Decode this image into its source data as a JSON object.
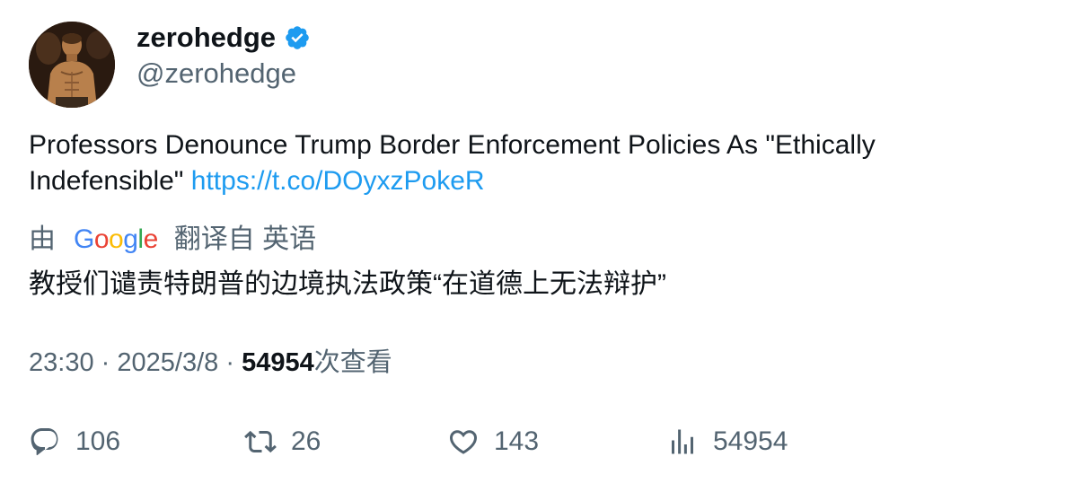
{
  "author": {
    "display_name": "zerohedge",
    "handle": "@zerohedge",
    "verified_icon": "verified-badge-icon",
    "verified_color": "#1d9bf0"
  },
  "tweet": {
    "text": "Professors Denounce Trump Border Enforcement Policies As \"Ethically Indefensible\" ",
    "link": "https://t.co/DOyxzPokeR",
    "link_color": "#1d9bf0"
  },
  "translation": {
    "prefix": "由",
    "provider": "Google",
    "suffix": "翻译自 英语",
    "text": "教授们谴责特朗普的边境执法政策“在道德上无法辩护”"
  },
  "meta": {
    "time": "23:30",
    "separator": "·",
    "date": "2025/3/8",
    "views": "54954",
    "views_label": "次查看"
  },
  "actions": {
    "replies": "106",
    "retweets": "26",
    "likes": "143",
    "views": "54954"
  },
  "colors": {
    "text": "#0f1419",
    "secondary": "#536471",
    "accent": "#1d9bf0"
  }
}
